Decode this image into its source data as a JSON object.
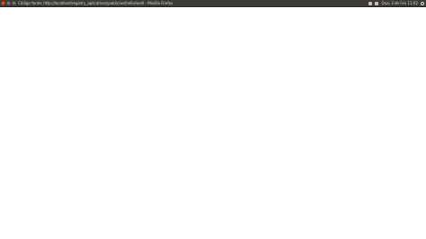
{
  "window": {
    "title": "Código-fonte: http://localhost/registry_aplicativos/public/ws/hello/wsdl - Mozilla Firefox"
  },
  "panel": {
    "clock": "Qua, 3 de Fev 11:02"
  },
  "source_lines": []
}
